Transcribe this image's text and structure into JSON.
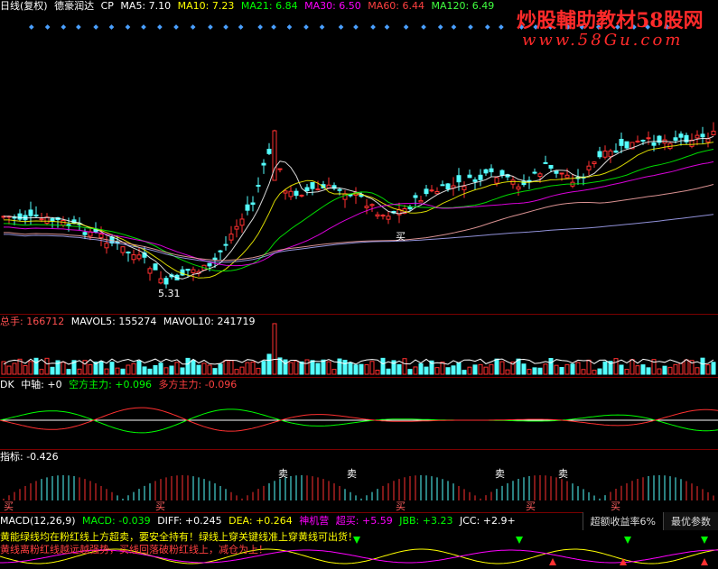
{
  "colors": {
    "up": "#ff3030",
    "down": "#54ffff",
    "ma5": "#ffffff",
    "ma10": "#ffff00",
    "ma21": "#00ff00",
    "ma30": "#ff00ff",
    "ma60": "#ff4040",
    "ma120": "#40ff40",
    "grid": "#7a0000"
  },
  "main": {
    "labels": [
      "日线(复权)",
      "德豪润达",
      "CP",
      "MA5: 7.10",
      "MA10: 7.23",
      "MA21: 6.84",
      "MA30: 6.50",
      "MA60: 6.44",
      "MA120: 6.49"
    ],
    "low_label": "5.31",
    "buy_label": "买"
  },
  "watermark": {
    "title": "炒股輔助教材58股网",
    "url": "www.58Gu.com"
  },
  "volume": {
    "labels": [
      "总手: 166712",
      "MAVOL5: 155274",
      "MAVOL10: 241719"
    ]
  },
  "osc": {
    "labels": [
      "DK",
      "中轴: +0",
      "空方主力: +0.096",
      "多方主力: -0.096"
    ]
  },
  "signal": {
    "labels": [
      "指标: -0.426"
    ],
    "sell_label": "卖",
    "buy_label": "买"
  },
  "macd": {
    "labels": [
      "MACD(12,26,9)",
      "MACD: -0.039",
      "DIFF: +0.245",
      "DEA: +0.264",
      "神机营",
      "超买: +5.59",
      "JBB: +3.23",
      "JCC: +2.9+"
    ],
    "notes": [
      "黄能绿线均在粉红线上方超卖，要安全持有！绿线上穿关键线准上穿黄线可出货！",
      "黄线离粉红线越远越强势，买线回落破粉红线上，减仓为上！"
    ]
  },
  "tabs": {
    "items": [
      "超额收益率6%",
      "最优参数"
    ]
  },
  "chart_data": {
    "type": "candlestick",
    "title": "德豪润达 日线(复权)",
    "series": [
      {
        "name": "MA5",
        "value": 7.1
      },
      {
        "name": "MA10",
        "value": 7.23
      },
      {
        "name": "MA21",
        "value": 6.84
      },
      {
        "name": "MA30",
        "value": 6.5
      },
      {
        "name": "MA60",
        "value": 6.44
      },
      {
        "name": "MA120",
        "value": 6.49
      }
    ],
    "low_annotation": 5.31,
    "volume": {
      "total": 166712,
      "mavol5": 155274,
      "mavol10": 241719
    },
    "indicators": {
      "macd": -0.039,
      "diff": 0.245,
      "dea": 0.264,
      "dk_axis": 0,
      "short_main": 0.096,
      "long_main": -0.096,
      "index": -0.426
    }
  }
}
